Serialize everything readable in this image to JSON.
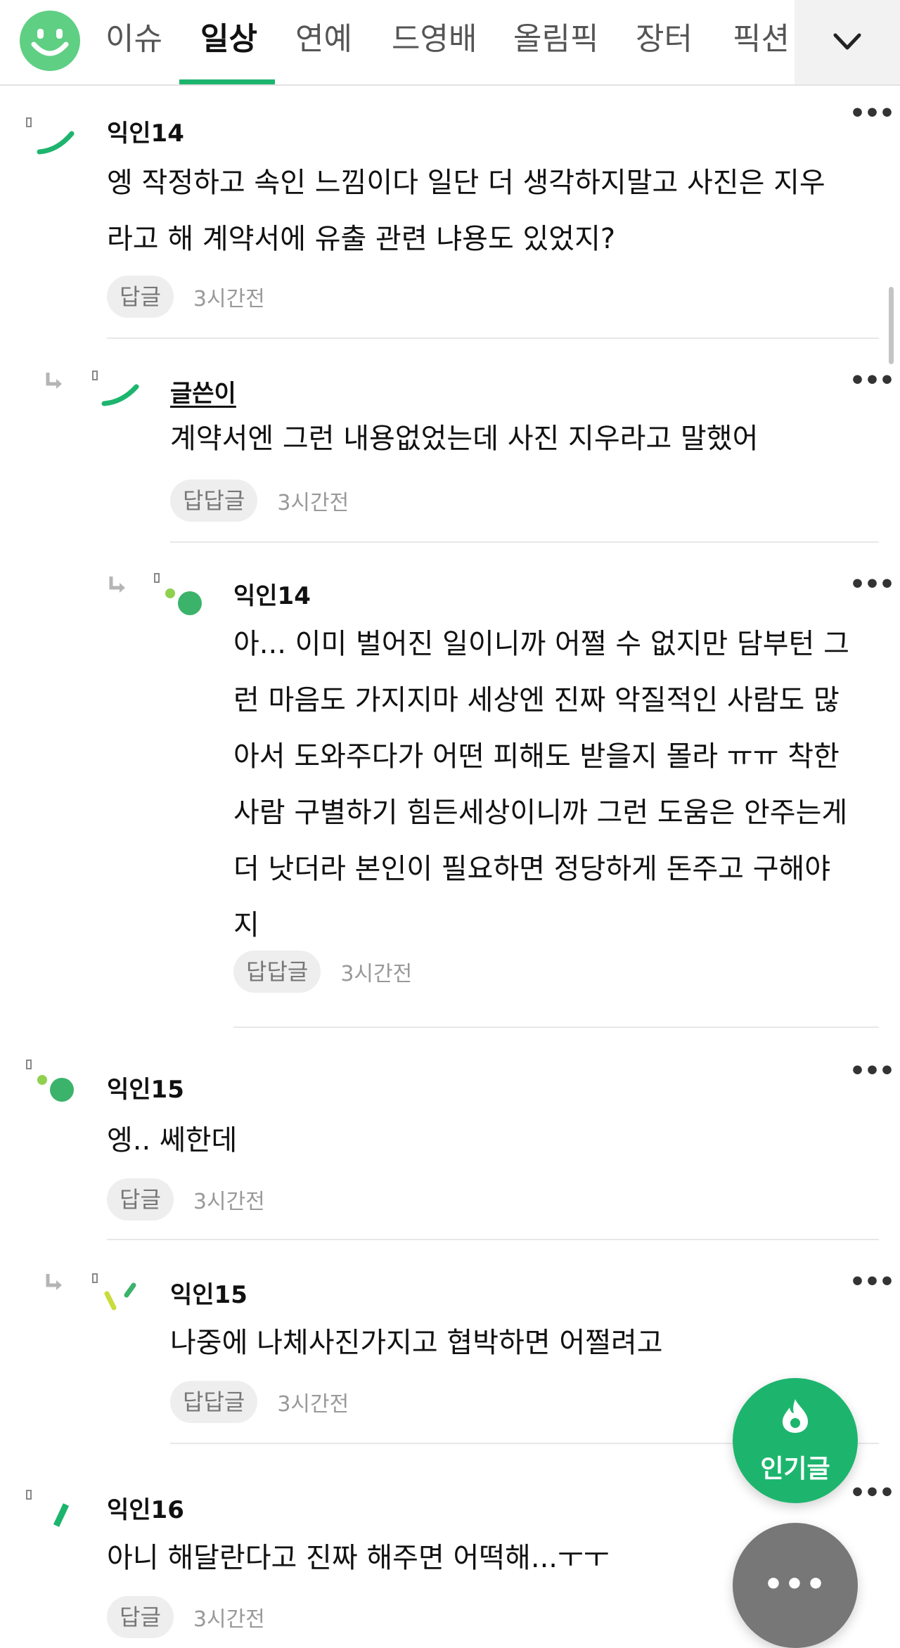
{
  "nav": {
    "tabs": [
      {
        "label": "이슈"
      },
      {
        "label": "일상"
      },
      {
        "label": "연예"
      },
      {
        "label": "드영배"
      },
      {
        "label": "올림픽"
      },
      {
        "label": "장터"
      },
      {
        "label": "픽션"
      }
    ],
    "active_tab": "일상",
    "accent_color": "#1db56e"
  },
  "comments": [
    {
      "nickname": "익인14",
      "body_lines": [
        "엥 작정하고 속인 느낌이다 일단 더 생각하지말고 사진은 지우",
        "라고 해 계약서에 유출 관련 냐용도 있었지?"
      ],
      "reply_label": "답글",
      "time": "3시간전"
    },
    {
      "nickname": "글쓴이",
      "body_lines": [
        "계약서엔 그런 내용없었는데 사진 지우라고 말했어"
      ],
      "reply_label": "답답글",
      "time": "3시간전"
    },
    {
      "nickname": "익인14",
      "body_lines": [
        "아... 이미 벌어진 일이니까 어쩔 수 없지만 담부턴 그",
        "런 마음도 가지지마 세상엔 진짜 악질적인 사람도 많",
        "아서 도와주다가 어떤 피해도 받을지 몰라 ㅠㅠ 착한",
        "사람 구별하기 힘든세상이니까 그런 도움은 안주는게",
        "더 낫더라 본인이 필요하면 정당하게 돈주고 구해야",
        "지"
      ],
      "reply_label": "답답글",
      "time": "3시간전"
    },
    {
      "nickname": "익인15",
      "body_lines": [
        "엥.. 쎄한데"
      ],
      "reply_label": "답글",
      "time": "3시간전"
    },
    {
      "nickname": "익인15",
      "body_lines": [
        "나중에 나체사진가지고 협박하면 어쩔려고"
      ],
      "reply_label": "답답글",
      "time": "3시간전"
    },
    {
      "nickname": "익인16",
      "body_lines": [
        "아니 해달란다고 진짜 해주면 어떡해...ㅜㅜ"
      ],
      "reply_label": "답글",
      "time": "3시간전"
    }
  ],
  "more_glyph": "•••",
  "fab": {
    "popular_label": "인기글",
    "popular_color": "#1db56e",
    "more_glyph": "•••",
    "more_color": "#777777"
  },
  "icons": [
    "smile-logo-icon",
    "chevron-down-icon",
    "reply-arrow-icon",
    "more-dots-icon",
    "fire-icon"
  ]
}
